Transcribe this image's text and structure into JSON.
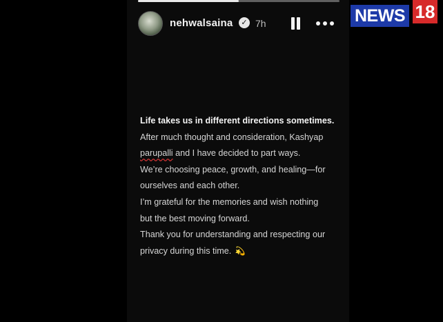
{
  "story": {
    "progress": 0.5,
    "username": "nehwalsaina",
    "verified_icon": "verified-badge-icon",
    "timestamp": "7h"
  },
  "message": {
    "line1": "Life takes us in different directions sometimes.",
    "line2": "After much thought and consideration, Kashyap",
    "line3_name": "parupalli",
    "line3_rest": " and I have decided to part ways.",
    "line4": "We’re choosing peace, growth, and healing—for",
    "line5": "ourselves and each other.",
    "line6": "I’m grateful for the memories and wish nothing",
    "line7": "but the best moving forward.",
    "line8": "Thank you for understanding and respecting our",
    "line9": "privacy during this time.",
    "emoji": "💫"
  },
  "watermark": {
    "brand_text": "NEWS",
    "brand_number": "18",
    "colors": {
      "brand_blue": "#1d3aa8",
      "brand_red": "#d72a2a"
    }
  }
}
